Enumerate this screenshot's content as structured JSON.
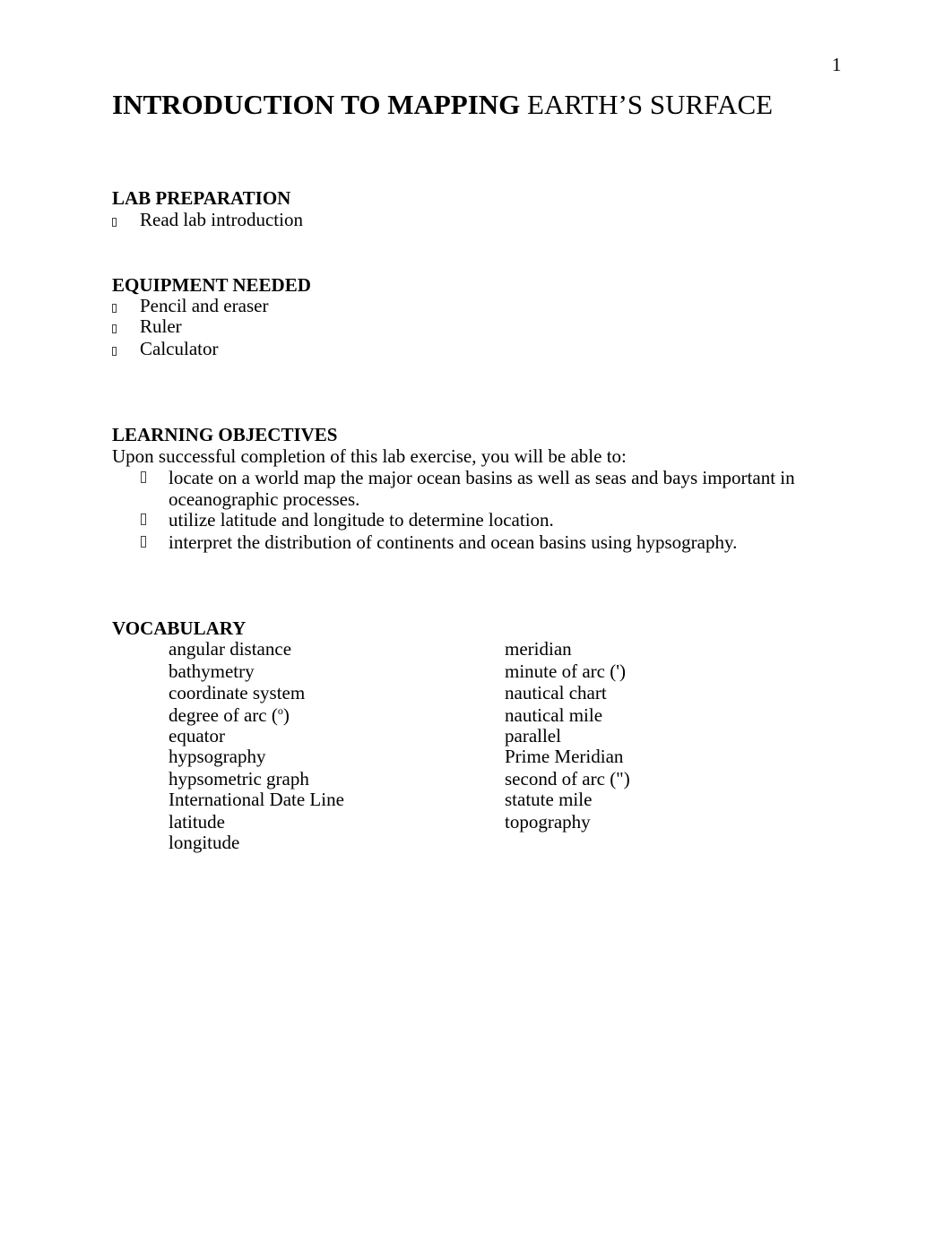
{
  "page_number": "1",
  "title": {
    "bold": "INTRODUCTION TO MAPPING",
    "regular": "EARTH’S SURFACE"
  },
  "lab_preparation": {
    "heading": "LAB PREPARATION",
    "items": [
      "Read lab introduction"
    ]
  },
  "equipment": {
    "heading": "EQUIPMENT NEEDED",
    "items": [
      "Pencil and eraser",
      "Ruler",
      "Calculator"
    ]
  },
  "objectives": {
    "heading": "LEARNING OBJECTIVES",
    "intro": "Upon successful completion of this lab exercise, you will be able to:",
    "items": [
      {
        "line1": "locate on a world map the major ocean basins as well as seas and bays important in",
        "line2": "oceanographic processes."
      },
      {
        "line1": "utilize latitude and longitude to determine location."
      },
      {
        "line1": "interpret the distribution of continents and ocean basins using hypsography."
      }
    ]
  },
  "vocabulary": {
    "heading": "VOCABULARY",
    "left": [
      "angular distance",
      "bathymetry",
      "coordinate system",
      "degree of arc (",
      "equator",
      "hypsography",
      "hypsometric graph",
      "International Date Line",
      "latitude",
      "longitude"
    ],
    "degree_sup": "o",
    "degree_close": ")",
    "right": [
      "meridian",
      "minute of arc (')",
      "nautical chart",
      "nautical mile",
      "parallel",
      "Prime Meridian",
      "second of arc (\")",
      "statute mile",
      "topography"
    ]
  }
}
